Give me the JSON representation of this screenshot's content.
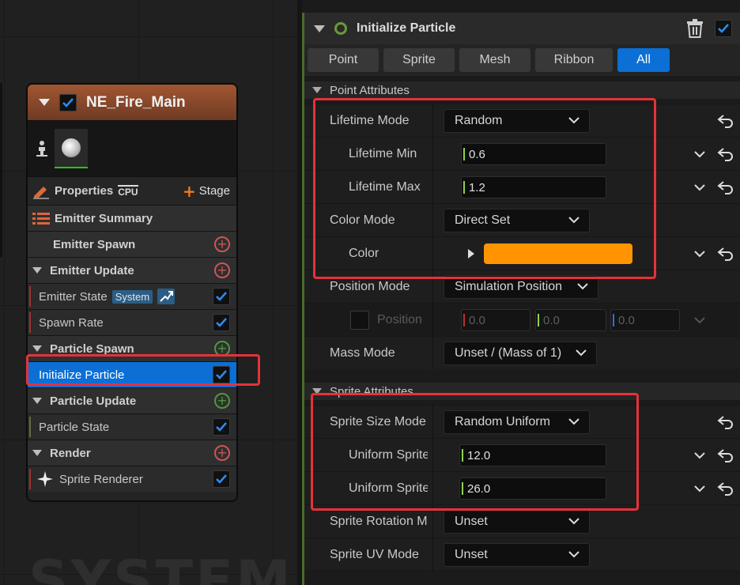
{
  "graph": {
    "watermark": "SYSTEM"
  },
  "node": {
    "title": "NE_Fire_Main",
    "properties_label": "Properties",
    "cpu_label": "CPU",
    "stage_label": "Stage",
    "rows": [
      {
        "label": "Emitter Summary",
        "kind": "section"
      },
      {
        "label": "Emitter Spawn",
        "kind": "section"
      },
      {
        "label": "Emitter Update",
        "kind": "section"
      },
      {
        "label": "Emitter State",
        "kind": "item",
        "badge": "System"
      },
      {
        "label": "Spawn Rate",
        "kind": "item"
      },
      {
        "label": "Particle Spawn",
        "kind": "section"
      },
      {
        "label": "Initialize Particle",
        "kind": "item",
        "selected": true
      },
      {
        "label": "Particle Update",
        "kind": "section"
      },
      {
        "label": "Particle State",
        "kind": "item"
      },
      {
        "label": "Render",
        "kind": "section"
      },
      {
        "label": "Sprite Renderer",
        "kind": "item"
      }
    ]
  },
  "panel": {
    "title": "Initialize Particle",
    "tabs": [
      "Point",
      "Sprite",
      "Mesh",
      "Ribbon",
      "All"
    ],
    "active_tab": "All",
    "point_section": "Point Attributes",
    "sprite_section": "Sprite Attributes",
    "props": {
      "lifetime_mode": {
        "label": "Lifetime Mode",
        "value": "Random"
      },
      "lifetime_min": {
        "label": "Lifetime Min",
        "value": "0.6"
      },
      "lifetime_max": {
        "label": "Lifetime Max",
        "value": "1.2"
      },
      "color_mode": {
        "label": "Color Mode",
        "value": "Direct Set"
      },
      "color": {
        "label": "Color",
        "swatch": "#ff9400"
      },
      "position_mode": {
        "label": "Position Mode",
        "value": "Simulation Position"
      },
      "position": {
        "label": "Position",
        "x": "0.0",
        "y": "0.0",
        "z": "0.0"
      },
      "mass_mode": {
        "label": "Mass Mode",
        "value": "Unset / (Mass of 1)"
      },
      "sprite_size_mode": {
        "label": "Sprite Size Mode",
        "value": "Random Uniform"
      },
      "uniform_sprite_min": {
        "label": "Uniform Sprite",
        "value": "12.0"
      },
      "uniform_sprite_max": {
        "label": "Uniform Sprite",
        "value": "26.0"
      },
      "sprite_rotation": {
        "label": "Sprite Rotation M",
        "value": "Unset"
      },
      "sprite_uv": {
        "label": "Sprite UV Mode",
        "value": "Unset"
      }
    }
  },
  "colors": {
    "accent_blue": "#0b6fd6",
    "highlight_red": "#e5323a",
    "header_orange": "#a25631"
  }
}
